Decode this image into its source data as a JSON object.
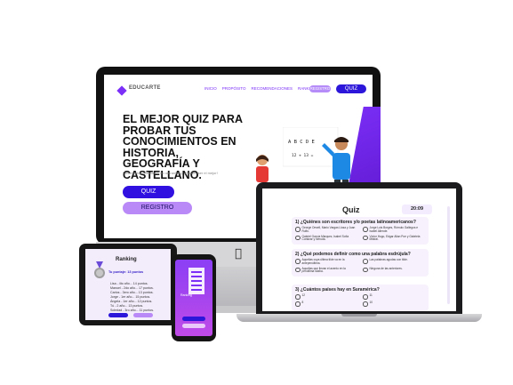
{
  "site": {
    "logo": "EDUCARTE",
    "nav": [
      "INICIO",
      "PROPÓSITO",
      "RECOMENDACIONES",
      "RANKING"
    ],
    "nav_registro": "REGISTRO",
    "nav_quiz": "QUIZ",
    "hero_title": "EL MEJOR QUIZ PARA PROBAR TUS CONOCIMIENTOS EN HISTORIA, GEOGRAFÍA Y CASTELLANO.",
    "hero_sub": "Observa tus resultados en un ranking, ¡Puedes ser el mejor!",
    "btn_quiz": "QUIZ",
    "btn_registro": "REGISTRO",
    "board_letters": "A B C D E",
    "board_math": "12 + 13 ="
  },
  "quiz": {
    "title": "Quiz",
    "timer": "20:09",
    "questions": [
      {
        "q": "1) ¿Quiénes son escritores y/o poetas latinoamericanos?",
        "options": [
          "George Orwell, Mario Vargas Llosa y Juan Rulfo.",
          "Jorge Luis Borges, Rómulo Gallegos e Isabel Allende.",
          "Gabriel García Márquez, Isabel Sofía Cortázar y Neruda.",
          "Víctor Hugo, Edgar Allan Poe y Gabriela Mistral."
        ]
      },
      {
        "q": "2) ¿Qué podemos definir como una palabra esdrújula?",
        "options": [
          "Aquellas cuya última tilde va en la antepenúltima.",
          "Las palabras agudas con tilde.",
          "Aquellas que llevan el acento en la penúltima sílaba.",
          "Ninguna de las anteriores."
        ]
      },
      {
        "q": "3) ¿Cuántos países hay en Suramérica?",
        "options": [
          "12",
          "11",
          "8",
          "10"
        ]
      }
    ]
  },
  "ranking": {
    "title": "Ranking",
    "score": "Tu puntaje: 13 puntos",
    "entries": [
      "Lisa - 4to año... 14 puntos.",
      "Manuel - 2do año... 17 puntos.",
      "Carlos - 3ero año... 13 puntos.",
      "Jorge - 1er año... 15 puntos.",
      "Ángela - 1er año... 12 puntos.",
      "Tú - 2 año... 13 puntos.",
      "Soledad - 3ro año... 11 puntos."
    ]
  },
  "phone": {
    "title": "Ranking"
  },
  "colors": {
    "accent": "#7b2ff7",
    "primary_button": "#3010e0",
    "secondary_button": "#b98af7",
    "soft_purple": "#f6f1fc"
  }
}
